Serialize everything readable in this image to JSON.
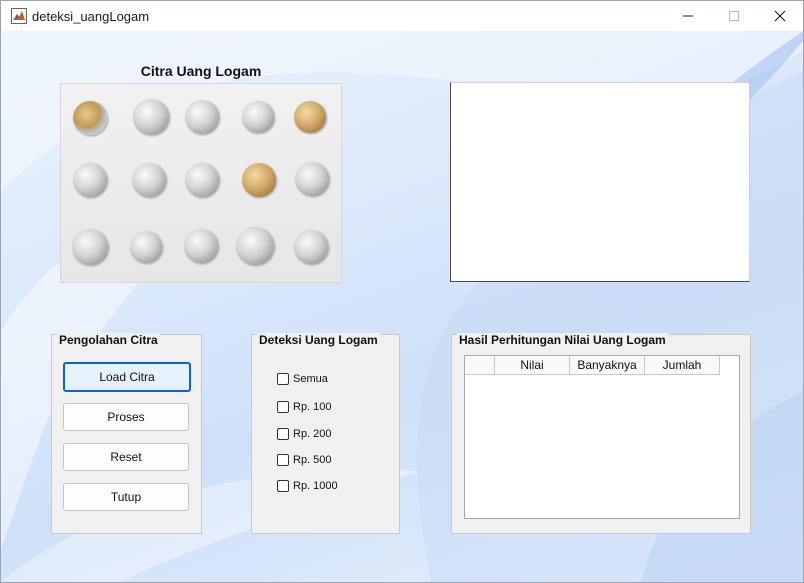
{
  "window": {
    "title": "deteksi_uangLogam",
    "icon": "matlab-icon",
    "controls": [
      "minimize-icon",
      "maximize-icon",
      "close-icon"
    ]
  },
  "image_axes": {
    "title": "Citra Uang Logam"
  },
  "processing_panel": {
    "title": "Pengolahan Citra",
    "buttons": {
      "load": "Load Citra",
      "process": "Proses",
      "reset": "Reset",
      "close": "Tutup"
    }
  },
  "detection_panel": {
    "title": "Deteksi Uang Logam",
    "options": {
      "all": "Semua",
      "rp100": "Rp. 100",
      "rp200": "Rp. 200",
      "rp500": "Rp. 500",
      "rp1000": "Rp. 1000"
    }
  },
  "result_panel": {
    "title": "Hasil Perhitungan Nilai Uang Logam",
    "columns": {
      "value": "Nilai",
      "count": "Banyaknya",
      "total": "Jumlah"
    }
  },
  "colors": {
    "accent": "#0a64d2",
    "matlab_icon": "#d9531e"
  }
}
